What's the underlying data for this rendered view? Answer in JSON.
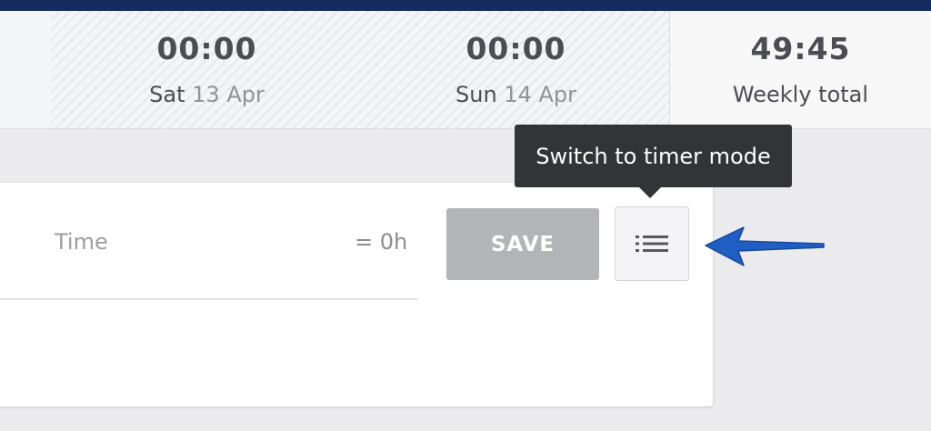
{
  "week": {
    "days": [
      {
        "time": "00:00",
        "dow": "Sat",
        "date": "13 Apr"
      },
      {
        "time": "00:00",
        "dow": "Sun",
        "date": "14 Apr"
      }
    ],
    "total": {
      "time": "49:45",
      "label": "Weekly total"
    }
  },
  "entry": {
    "time_placeholder": "Time",
    "computed": "= 0h",
    "save_label": "SAVE"
  },
  "tooltip": {
    "text": "Switch to timer mode"
  },
  "icons": {
    "mode_button": "list-icon",
    "annotation": "arrow-left-icon"
  },
  "colors": {
    "topbar": "#142d5e",
    "save_disabled": "#b3b4b7",
    "tooltip_bg": "#333436",
    "annotation_arrow": "#1f5fc4"
  }
}
